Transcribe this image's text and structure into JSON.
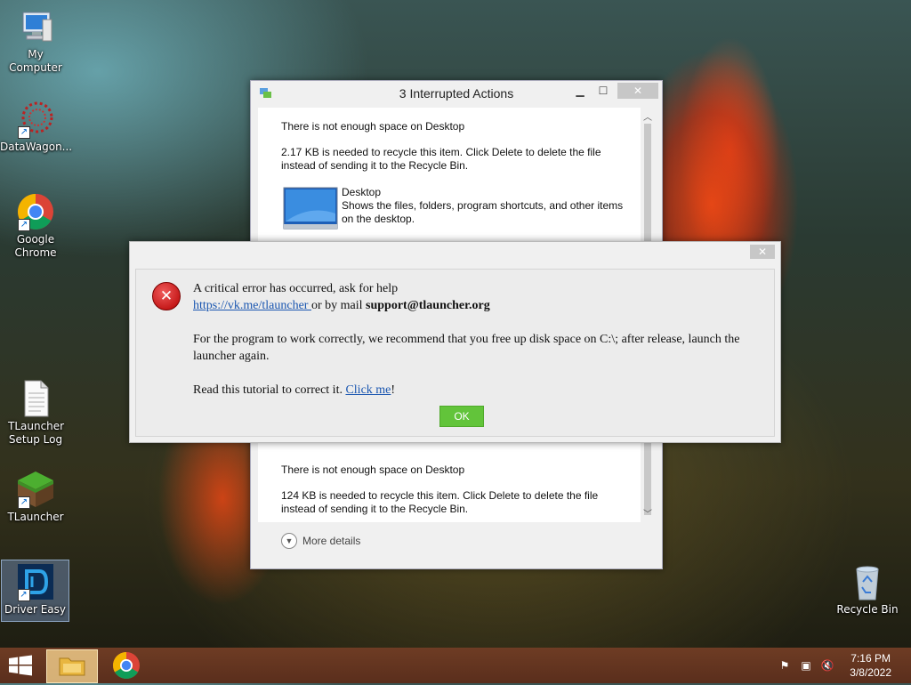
{
  "desktop": {
    "icons": [
      {
        "label": "My Computer"
      },
      {
        "label": "DataWagon..."
      },
      {
        "label": "Google Chrome"
      },
      {
        "label": "TLauncher Setup Log"
      },
      {
        "label": "TLauncher"
      },
      {
        "label": "Driver Easy"
      },
      {
        "label": "Recycle Bin"
      }
    ]
  },
  "interrupted_window": {
    "title": "3 Interrupted Actions",
    "minimize": "▁",
    "maximize": "☐",
    "close": "✕",
    "item1": {
      "heading": "There is not enough space on Desktop",
      "message": "2.17 KB is needed to recycle this item. Click Delete to delete the file instead of sending it to the Recycle Bin.",
      "folder_name": "Desktop",
      "folder_desc": "Shows the files, folders, program shortcuts, and other items on the desktop."
    },
    "item2": {
      "heading": "There is not enough space on Desktop",
      "message": "124 KB is needed to recycle this item. Click Delete to delete the file instead of sending it to the Recycle Bin."
    },
    "more_details": "More details"
  },
  "error_dialog": {
    "close": "✕",
    "line1": "A critical error has occurred, ask for help",
    "link1": "https://vk.me/tlauncher ",
    "mail_prefix": "or by mail ",
    "mail": "support@tlauncher.org",
    "line3": "For the program to work correctly, we recommend that you free up disk space on C:\\; after release, launch the launcher again.",
    "tutorial_prefix": "Read this tutorial to correct it. ",
    "tutorial_link": "Click me",
    "tutorial_suffix": "!",
    "ok": "OK"
  },
  "taskbar": {
    "time": "7:16 PM",
    "date": "3/8/2022"
  },
  "colors": {
    "ok_button": "#62c43a",
    "link": "#1a56b0",
    "error_icon": "#c40000",
    "taskbar": "#5e311e"
  }
}
